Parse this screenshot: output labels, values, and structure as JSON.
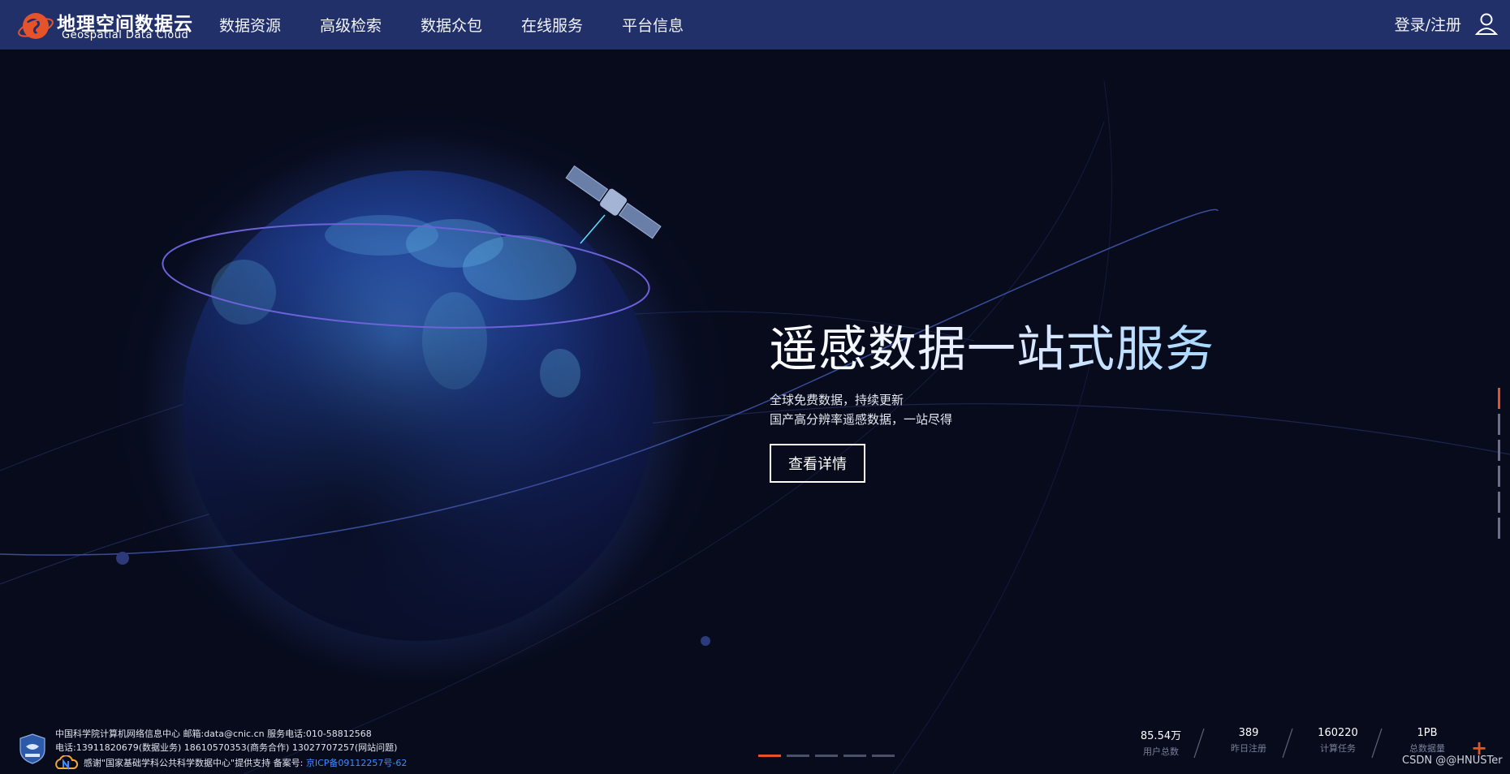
{
  "header": {
    "logo_cn": "地理空间数据云",
    "logo_en": "Geospatial Data Cloud",
    "nav": [
      "数据资源",
      "高级检索",
      "数据众包",
      "在线服务",
      "平台信息"
    ],
    "login": "登录/注册"
  },
  "hero": {
    "title": "遥感数据一站式服务",
    "subtitle_1": "全球免费数据，持续更新",
    "subtitle_2": "国产高分辨率遥感数据，一站尽得",
    "button": "查看详情"
  },
  "side_nav": {
    "count": 6,
    "active": 0
  },
  "carousel": {
    "count": 5,
    "active": 0
  },
  "footer": {
    "line1": "中国科学院计算机网络信息中心 邮箱:data@cnic.cn 服务电话:010-58812568",
    "line2": "电话:13911820679(数据业务) 18610570353(商务合作) 13027707257(网站问题)",
    "line3": "感谢\"国家基础学科公共科学数据中心\"提供支持 备案号:",
    "icp": "京ICP备09112257号-62"
  },
  "stats": [
    {
      "value": "85.54万",
      "label": "用户总数"
    },
    {
      "value": "389",
      "label": "昨日注册"
    },
    {
      "value": "160220",
      "label": "计算任务"
    },
    {
      "value": "1PB",
      "label": "总数据量"
    }
  ],
  "watermark": "CSDN @@HNUSTer",
  "colors": {
    "header_bg": "#22306a",
    "accent": "#e5532b",
    "page_bg": "#070b1c",
    "link": "#3f8cff"
  }
}
